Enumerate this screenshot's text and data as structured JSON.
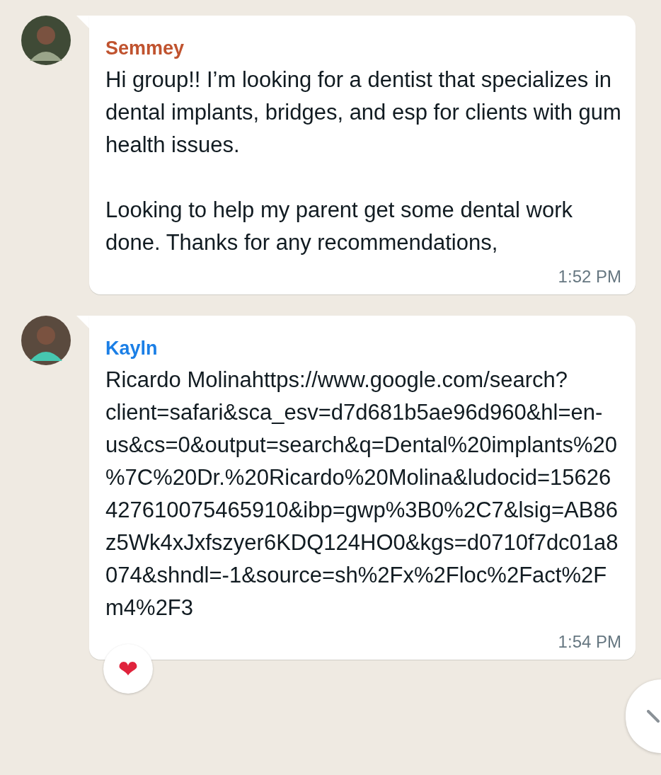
{
  "messages": [
    {
      "sender": "Semmey",
      "color": "#c0532f",
      "paragraphs": [
        "Hi group!! I’m looking for a dentist that specializes in dental implants, bridges, and esp for clients with gum health issues.",
        "Looking to help my parent get some dental work done. Thanks for any recommendations,"
      ],
      "time": "1:52 PM"
    },
    {
      "sender": "Kayln",
      "color": "#1b7fe6",
      "paragraphs": [
        "Ricardo Molinahttps://www.google.com/search?client=safari&sca_esv=d7d681b5ae96d960&hl=en-us&cs=0&output=search&q=Dental%20implants%20%7C%20Dr.%20Ricardo%20Molina&ludocid=15626427610075465910&ibp=gwp%3B0%2C7&lsig=AB86z5Wk4xJxfszyer6KDQ124HO0&kgs=d0710f7dc01a8074&shndl=-1&source=sh%2Fx%2Floc%2Fact%2Fm4%2F3"
      ],
      "time": "1:54 PM",
      "reactions": [
        "❤"
      ]
    }
  ]
}
